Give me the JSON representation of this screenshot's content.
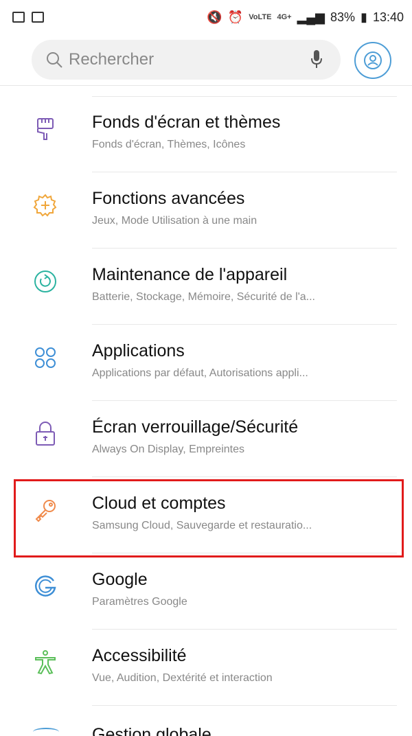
{
  "status_bar": {
    "battery": "83%",
    "time": "13:40",
    "network": "4G+",
    "volte": "VoLTE"
  },
  "search": {
    "placeholder": "Rechercher"
  },
  "items": [
    {
      "title": "Fonds d'écran et thèmes",
      "subtitle": "Fonds d'écran, Thèmes, Icônes",
      "icon": "paint-brush-icon",
      "color": "#7d5bb5"
    },
    {
      "title": "Fonctions avancées",
      "subtitle": "Jeux, Mode Utilisation à une main",
      "icon": "gear-plus-icon",
      "color": "#f0a63a"
    },
    {
      "title": "Maintenance de l'appareil",
      "subtitle": "Batterie, Stockage, Mémoire, Sécurité de l'a...",
      "icon": "maintenance-icon",
      "color": "#2bb3a0"
    },
    {
      "title": "Applications",
      "subtitle": "Applications par défaut, Autorisations appli...",
      "icon": "apps-grid-icon",
      "color": "#3e8fd6"
    },
    {
      "title": "Écran verrouillage/Sécurité",
      "subtitle": "Always On Display, Empreintes",
      "icon": "lock-icon",
      "color": "#7d5bb5"
    },
    {
      "title": "Cloud et comptes",
      "subtitle": "Samsung Cloud, Sauvegarde et restauratio...",
      "icon": "key-icon",
      "color": "#f08a4b"
    },
    {
      "title": "Google",
      "subtitle": "Paramètres Google",
      "icon": "google-icon",
      "color": "#3e8fd6"
    },
    {
      "title": "Accessibilité",
      "subtitle": "Vue, Audition, Dextérité et interaction",
      "icon": "accessibility-icon",
      "color": "#5bbf5a"
    }
  ],
  "partial_item": {
    "title": "Gestion globale"
  },
  "colors": {
    "highlight": "#e11b1b",
    "accent": "#4d9dd6"
  }
}
